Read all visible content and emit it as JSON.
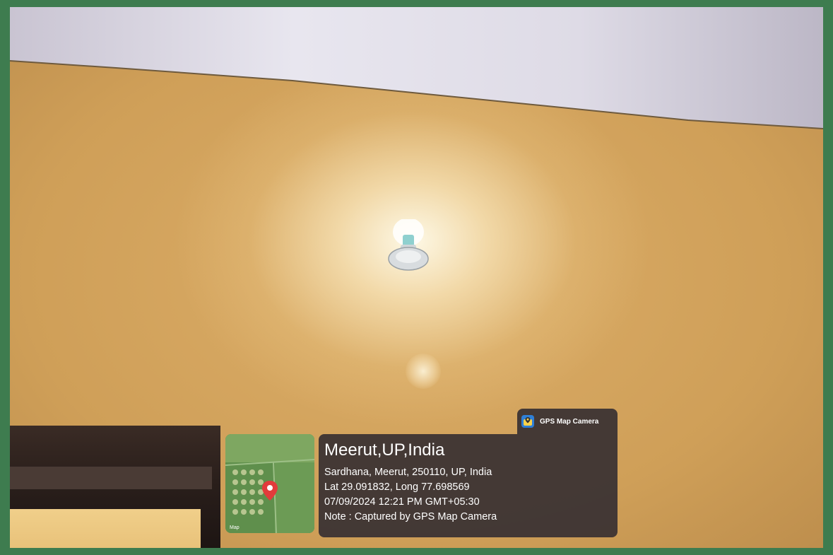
{
  "overlay": {
    "app_badge": {
      "label": "GPS Map Camera",
      "icon": "gps-map-camera-app-icon"
    },
    "map_thumbnail": {
      "label": "Map",
      "pin_color": "#e23b3b"
    },
    "location": {
      "title": "Meerut,UP,India",
      "address": "Sardhana, Meerut, 250110, UP, India",
      "coordinates": "Lat 29.091832, Long 77.698569",
      "datetime": "07/09/2024 12:21 PM GMT+05:30",
      "note": "Note : Captured by GPS Map Camera"
    }
  },
  "colors": {
    "frame": "#3e7c4f",
    "wall": "#d3a55e",
    "ceiling": "#ddd9e6",
    "panel": "#373032"
  }
}
